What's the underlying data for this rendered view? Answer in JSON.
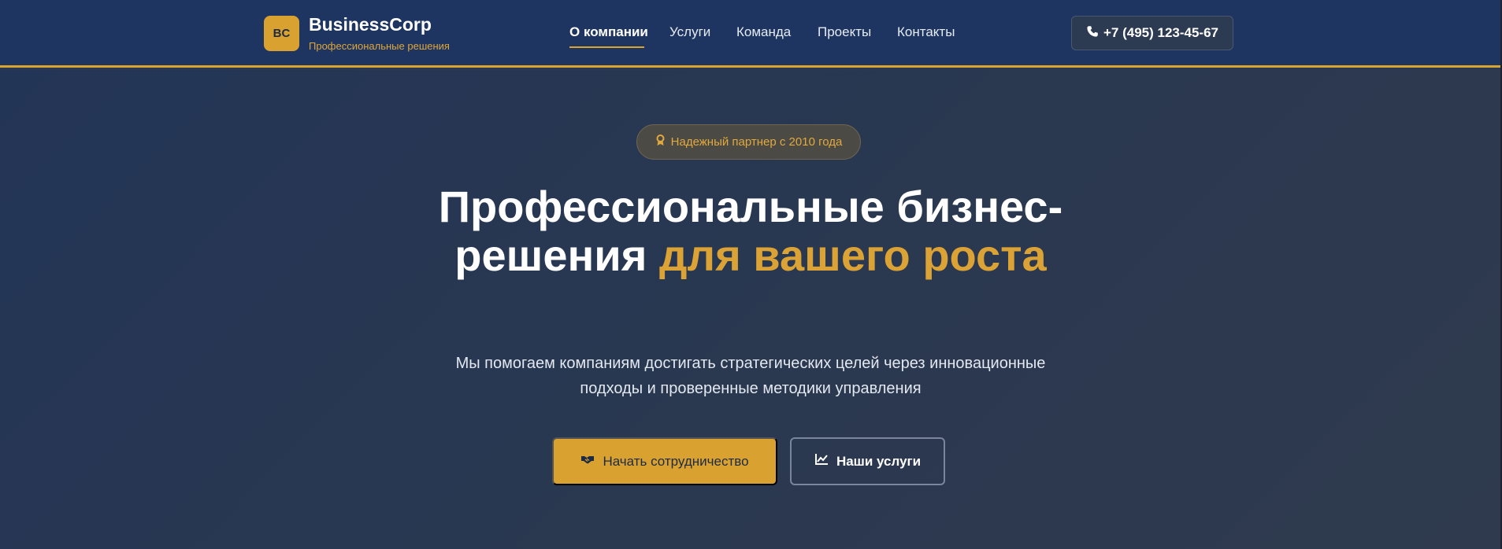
{
  "header": {
    "logo_initials": "BC",
    "brand_name": "BusinessCorp",
    "brand_tagline": "Профессиональные решения",
    "nav": [
      {
        "label": "О компании",
        "active": true
      },
      {
        "label": "Услуги",
        "active": false
      },
      {
        "label": "Команда",
        "active": false
      },
      {
        "label": "Проекты",
        "active": false
      },
      {
        "label": "Контакты",
        "active": false
      }
    ],
    "phone": "+7 (495) 123-45-67",
    "phone_icon": "phone-icon"
  },
  "hero": {
    "badge_text": "Надежный партнер с 2010 года",
    "badge_icon": "award-icon",
    "title_part1": "Профессиональные бизнес-решения ",
    "title_accent": "для вашего роста",
    "subtitle": "Мы помогаем компаниям достигать стратегических целей через инновационные подходы и проверенные методики управления",
    "primary_button": {
      "label": "Начать сотрудничество",
      "icon": "handshake-icon"
    },
    "secondary_button": {
      "label": "Наши услуги",
      "icon": "chart-line-icon"
    }
  },
  "colors": {
    "header_bg": "#1d3560",
    "accent": "#d9a230",
    "hero_bg": "#2a3850",
    "text_primary": "#ffffff"
  }
}
